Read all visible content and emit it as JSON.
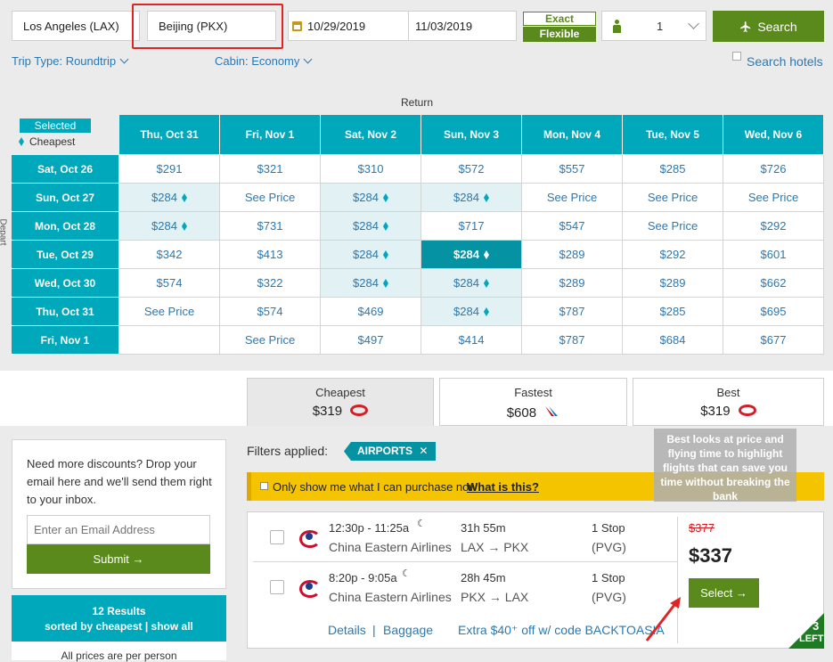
{
  "search": {
    "origin": "Los Angeles (LAX)",
    "destination": "Beijing (PKX)",
    "depart_date": "10/29/2019",
    "return_date": "11/03/2019",
    "exact_label": "Exact",
    "flexible_label": "Flexible",
    "travelers": "1",
    "search_label": "Search",
    "trip_type": "Trip Type: Roundtrip",
    "cabin": "Cabin: Economy",
    "search_hotels": "Search hotels"
  },
  "grid": {
    "return_label": "Return",
    "depart_label": "Depart",
    "selected_label": "Selected",
    "cheapest_label": "Cheapest",
    "columns": [
      "Thu, Oct 31",
      "Fri, Nov 1",
      "Sat, Nov 2",
      "Sun, Nov 3",
      "Mon, Nov 4",
      "Tue, Nov 5",
      "Wed, Nov 6"
    ],
    "rows": [
      {
        "label": "Sat, Oct 26",
        "cells": [
          "$291",
          "$321",
          "$310",
          "$572",
          "$557",
          "$285",
          "$726"
        ]
      },
      {
        "label": "Sun, Oct 27",
        "cells": [
          "$284",
          "See Price",
          "$284",
          "$284",
          "See Price",
          "See Price",
          "See Price"
        ]
      },
      {
        "label": "Mon, Oct 28",
        "cells": [
          "$284",
          "$731",
          "$284",
          "$717",
          "$547",
          "See Price",
          "$292"
        ]
      },
      {
        "label": "Tue, Oct 29",
        "cells": [
          "$342",
          "$413",
          "$284",
          "$284",
          "$289",
          "$292",
          "$601"
        ]
      },
      {
        "label": "Wed, Oct 30",
        "cells": [
          "$574",
          "$322",
          "$284",
          "$284",
          "$289",
          "$289",
          "$662"
        ]
      },
      {
        "label": "Thu, Oct 31",
        "cells": [
          "See Price",
          "$574",
          "$469",
          "$284",
          "$787",
          "$285",
          "$695"
        ]
      },
      {
        "label": "Fri, Nov 1",
        "cells": [
          "",
          "See Price",
          "$497",
          "$414",
          "$787",
          "$684",
          "$677"
        ]
      }
    ]
  },
  "sort_tabs": [
    {
      "label": "Cheapest",
      "price": "$319"
    },
    {
      "label": "Fastest",
      "price": "$608"
    },
    {
      "label": "Best",
      "price": "$319"
    }
  ],
  "tooltip": "Best looks at price and flying time to highlight flights that can save you time without breaking the bank",
  "newsletter": {
    "text": "Need more discounts? Drop your email here and we'll send them right to your inbox.",
    "placeholder": "Enter an Email Address",
    "submit": "Submit"
  },
  "results_summary": {
    "count": "12 Results",
    "sorted": "sorted by cheapest",
    "show_all": "show all",
    "note": "All prices are per person"
  },
  "filters": {
    "label": "Filters applied:",
    "chip": "AIRPORTS",
    "purchase_text": "Only show me what I can purchase now",
    "what_link": "What is this?"
  },
  "result": {
    "outbound": {
      "time": "12:30p - 11:25a",
      "airline": "China Eastern Airlines",
      "duration": "31h 55m",
      "route_from": "LAX",
      "route_to": "PKX",
      "stops": "1 Stop",
      "via": "(PVG)"
    },
    "inbound": {
      "time": "8:20p - 9:05a",
      "airline": "China Eastern Airlines",
      "duration": "28h 45m",
      "route_from": "PKX",
      "route_to": "LAX",
      "stops": "1 Stop",
      "via": "(PVG)"
    },
    "old_price": "$377",
    "price": "$337",
    "select": "Select",
    "details": "Details",
    "baggage": "Baggage",
    "promo": "Extra $40⁺ off w/ code BACKTOASIA",
    "seats_left_num": "3",
    "seats_left_label": "LEFT"
  }
}
